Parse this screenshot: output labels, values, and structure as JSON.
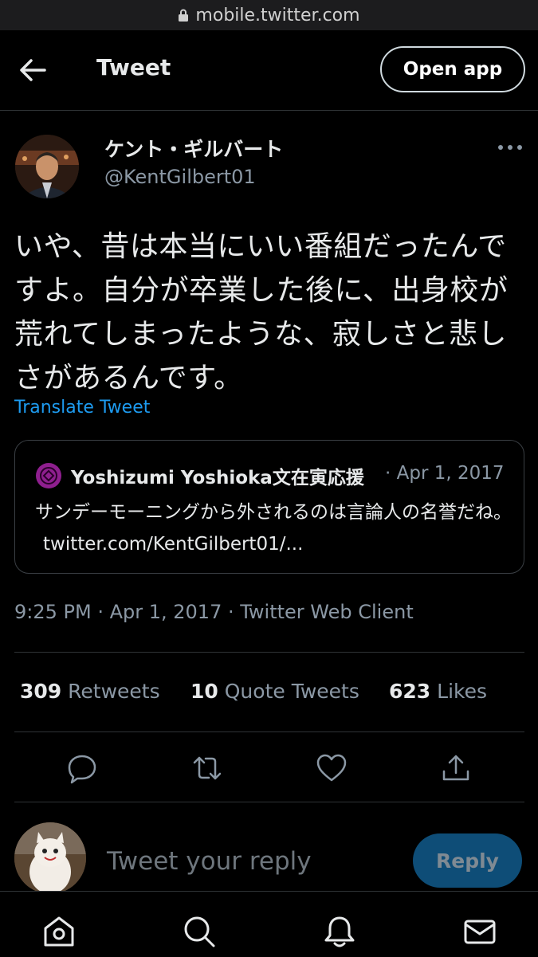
{
  "browser": {
    "url": "mobile.twitter.com"
  },
  "header": {
    "title": "Tweet",
    "open_app_label": "Open app"
  },
  "tweet": {
    "display_name": "ケント・ギルバート",
    "handle": "@KentGilbert01",
    "text": "いや、昔は本当にいい番組だったんですよ。自分が卒業した後に、出身校が荒れてしまったような、寂しさと悲しさがあるんです。",
    "translate_label": "Translate Tweet",
    "meta": "9:25 PM · Apr 1, 2017 · Twitter Web Client"
  },
  "quote": {
    "name": "Yoshizumi Yoshioka文在寅応援",
    "date": "· Apr 1, 2017",
    "text": "サンデーモーニングから外されるのは言論人の名誉だね。",
    "link": "twitter.com/KentGilbert01/..."
  },
  "stats": {
    "retweets_count": "309",
    "retweets_label": "Retweets",
    "quotes_count": "10",
    "quotes_label": "Quote Tweets",
    "likes_count": "623",
    "likes_label": "Likes"
  },
  "reply": {
    "placeholder": "Tweet your reply",
    "button_label": "Reply"
  },
  "icons": {
    "actions": [
      "reply-icon",
      "retweet-icon",
      "like-icon",
      "share-icon"
    ],
    "nav": [
      "home-icon",
      "search-icon",
      "notifications-icon",
      "messages-icon"
    ]
  },
  "colors": {
    "link": "#1d9bf0",
    "reply_button": "#0e4d77",
    "secondary_text": "#8b98a5",
    "quote_avatar": "#8f1f8f"
  }
}
